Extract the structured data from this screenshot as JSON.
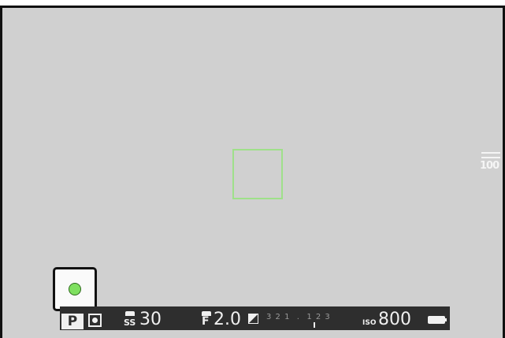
{
  "viewfinder": {
    "side_indicator": {
      "icon": "film-simulation-icon",
      "value": "100"
    },
    "focus_indicator": {
      "color": "#7fe060"
    }
  },
  "info_bar": {
    "mode": "P",
    "metering_icon": "metering-icon",
    "shutter_label": "SS",
    "shutter_value": "30",
    "aperture_label": "F",
    "aperture_value": "2.0",
    "exposure_icon": "exposure-compensation-icon",
    "exposure_scale": "3 2 1  .  1 2 3",
    "iso_label": "ISO",
    "iso_value": "800",
    "battery_icon": "battery-icon"
  }
}
